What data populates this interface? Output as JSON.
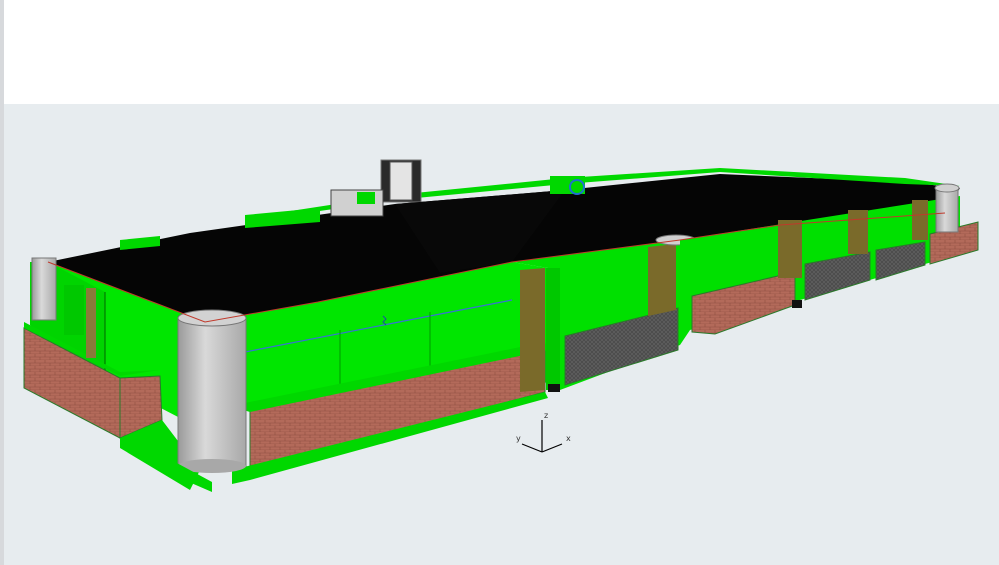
{
  "viewport": {
    "background": "#e7ecef",
    "model": {
      "colors": {
        "walls": "#00e000",
        "floor": "#000000",
        "brick": "#b36a5a",
        "column": "#c8c8c8",
        "panel": "#5b5b5b",
        "opening": "#7a6a2a"
      }
    },
    "axis_gizmo": {
      "z": "z",
      "y": "y",
      "x": "x"
    }
  }
}
